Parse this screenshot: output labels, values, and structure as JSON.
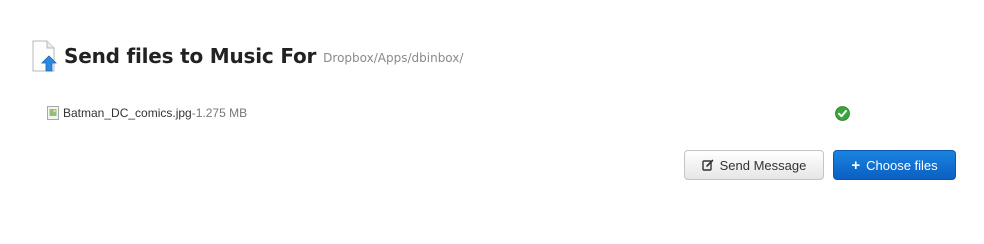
{
  "header": {
    "title": "Send files to Music For",
    "path": "Dropbox/Apps/dbinbox/"
  },
  "file": {
    "name": "Batman_DC_comics.jpg",
    "separator": "-",
    "size": "1.275 MB",
    "status": "uploaded"
  },
  "buttons": {
    "send_message": "Send Message",
    "choose_plus": "+",
    "choose_files": "Choose files"
  },
  "icons": {
    "header": "document-upload-icon",
    "file": "image-file-icon",
    "status": "checkmark-icon",
    "send": "edit-icon"
  },
  "colors": {
    "accent": "#0b6fd0",
    "upload_arrow": "#2a8ae0",
    "success": "#3aa53a"
  }
}
